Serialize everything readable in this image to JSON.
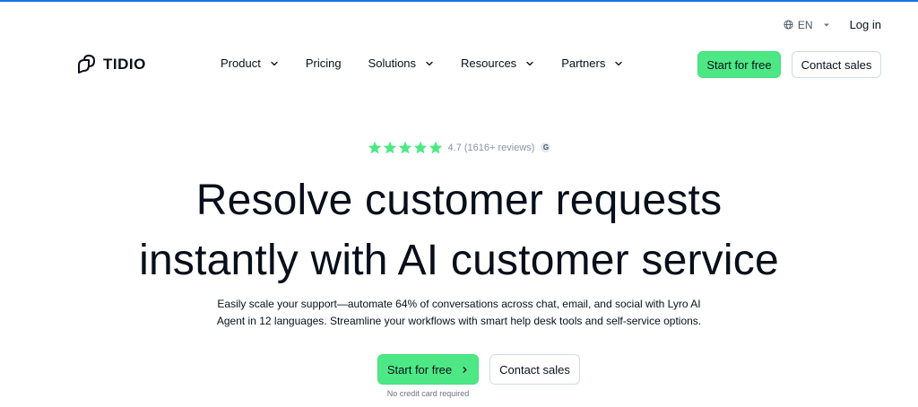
{
  "header": {
    "language": "EN",
    "login_label": "Log in",
    "logo_text": "TIDIO",
    "menu": [
      {
        "label": "Product",
        "has_dropdown": true
      },
      {
        "label": "Pricing",
        "has_dropdown": false
      },
      {
        "label": "Solutions",
        "has_dropdown": true
      },
      {
        "label": "Resources",
        "has_dropdown": true
      },
      {
        "label": "Partners",
        "has_dropdown": true
      }
    ],
    "start_free_label": "Start for free",
    "contact_sales_label": "Contact sales"
  },
  "hero": {
    "rating_stars": 5,
    "rating_text": "4.7 (1616+ reviews)",
    "rating_badge": "G",
    "headline_line1": "Resolve customer requests",
    "headline_line2": "instantly with AI customer service",
    "sub_line1": "Easily scale your support—automate 64% of conversations across chat, email, and social with Lyro AI",
    "sub_line2": "Agent in 12 languages. Streamline your workflows with smart help desk tools and self-service options.",
    "start_free_label": "Start for free",
    "contact_sales_label": "Contact sales",
    "no_card_note": "No credit card required"
  },
  "colors": {
    "accent_green": "#4de885",
    "text_dark": "#080f1a",
    "star_green": "#4de885",
    "top_bar_blue": "#1a73e8"
  },
  "icons": {
    "language": "globe-icon",
    "dropdown": "chevron-down-icon",
    "cta_arrow": "chevron-right-icon",
    "rating": "star-icon"
  }
}
